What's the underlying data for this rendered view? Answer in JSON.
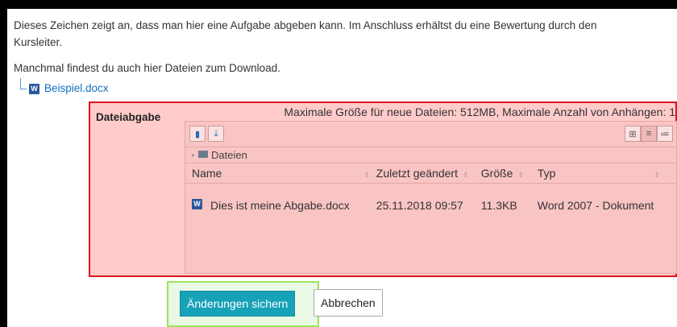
{
  "intro": {
    "line1": "Dieses Zeichen zeigt an, dass man hier eine Aufgabe abgeben kann. Im Anschluss erhältst du eine Bewertung durch den Kursleiter.",
    "line2": "Manchmal findest du auch hier Dateien zum Download."
  },
  "attachment": {
    "name": "Beispiel.docx",
    "icon": "word-doc-icon"
  },
  "submission": {
    "label": "Dateiabgabe",
    "max_info": "Maximale Größe für neue Dateien: 512MB, Maximale Anzahl von Anhängen: 1",
    "path": "Dateien",
    "columns": [
      "Name",
      "Zuletzt geändert",
      "Größe",
      "Typ"
    ],
    "files": [
      {
        "name": "Dies ist meine Abgabe.docx",
        "modified": "25.11.2018 09:57",
        "size": "11.3KB",
        "type": "Word 2007 - Dokument"
      }
    ]
  },
  "buttons": {
    "save": "Änderungen sichern",
    "cancel": "Abbrechen"
  },
  "colors": {
    "highlight_red": "#e0121b",
    "highlight_green": "#9be55a",
    "save_bg": "#17a2b8",
    "link": "#0f6fc5"
  }
}
